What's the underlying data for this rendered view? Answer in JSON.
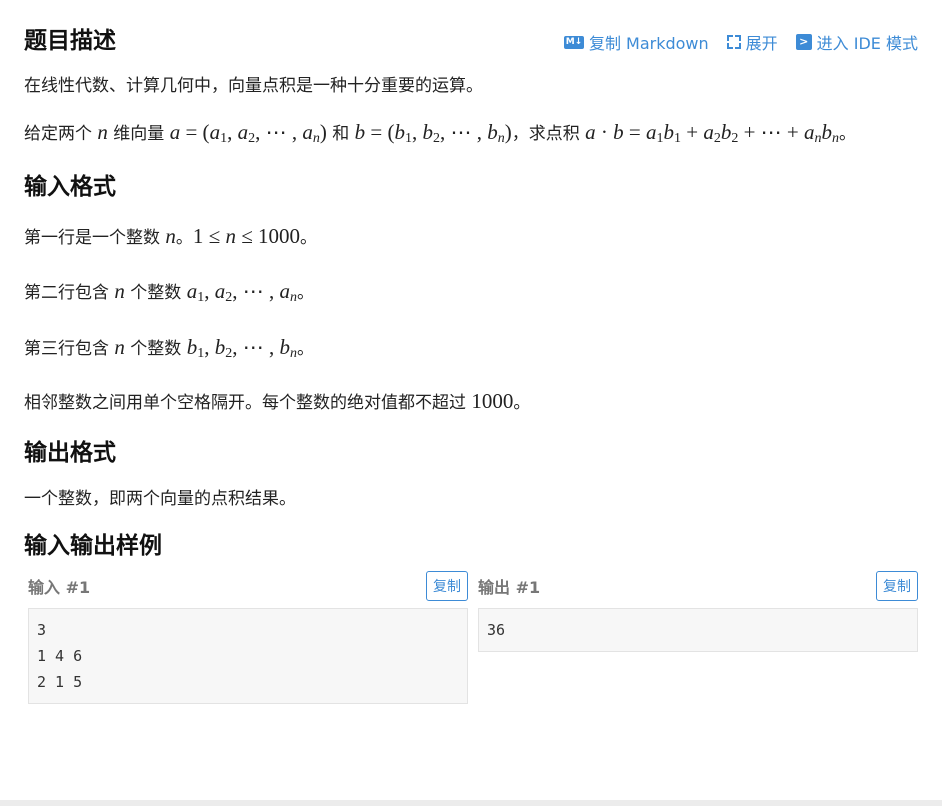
{
  "description": {
    "title": "题目描述",
    "actions": {
      "copy_markdown": "复制 Markdown",
      "expand": "展开",
      "ide_mode": "进入 IDE 模式"
    },
    "p1": "在线性代数、计算几何中，向量点积是一种十分重要的运算。",
    "p2": {
      "t1": "给定两个 ",
      "t2": " 维向量 ",
      "t3": " 和 ",
      "t4": "，求点积 ",
      "t5": "。"
    }
  },
  "input_format": {
    "title": "输入格式",
    "l1a": "第一行是一个整数 ",
    "l1b": "。",
    "l1c": "1 ≤ ",
    "l1d": " ≤ 1000",
    "l1e": "。",
    "l2a": "第二行包含 ",
    "l2b": " 个整数 ",
    "l2c": "。",
    "l3a": "第三行包含 ",
    "l3b": " 个整数 ",
    "l3c": "。",
    "l4a": "相邻整数之间用单个空格隔开。每个整数的绝对值都不超过 ",
    "l4b": "1000",
    "l4c": "。"
  },
  "output_format": {
    "title": "输出格式",
    "text": "一个整数，即两个向量的点积结果。"
  },
  "samples": {
    "title": "输入输出样例",
    "copy_label": "复制",
    "input": {
      "label": "输入 #1",
      "lines": [
        "3",
        "1 4 6",
        "2 1 5"
      ]
    },
    "output": {
      "label": "输出 #1",
      "lines": [
        "36"
      ]
    }
  },
  "accent_color": "#3d8bd6"
}
